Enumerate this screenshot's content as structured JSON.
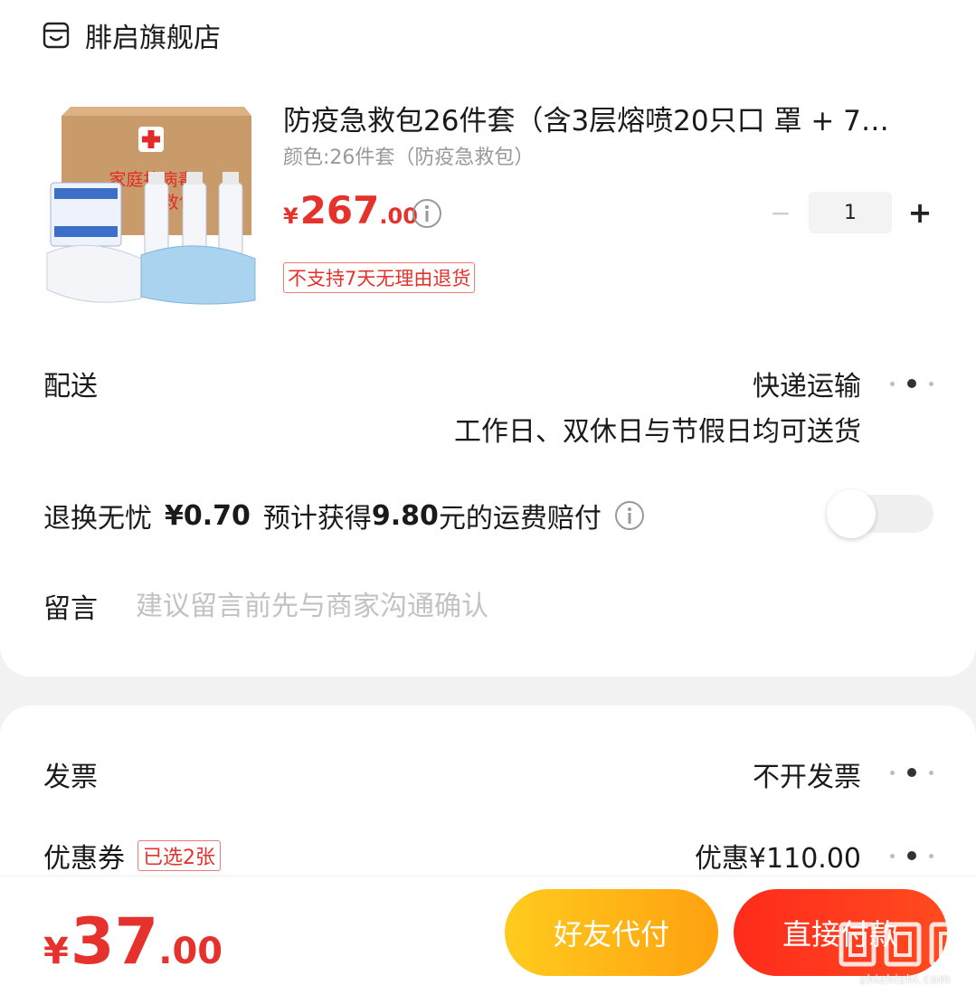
{
  "shop": {
    "name": "腓启旗舰店",
    "icon": "shop-icon"
  },
  "product": {
    "title": "防疫急救包26件套（含3层熔喷20只口 罩 + 7…",
    "variant": "颜色:26件套（防疫急救包）",
    "price_currency": "¥",
    "price_int": "267",
    "price_dec": ".00",
    "quantity": "1",
    "qty_minus": "−",
    "qty_plus": "+",
    "return_tag": "不支持7天无理由退货",
    "image_text_line1": "家庭抗病毒",
    "image_text_line2": "急救包"
  },
  "delivery": {
    "label": "配送",
    "method": "快递运输",
    "note": "工作日、双休日与节假日均可送货"
  },
  "return_worry": {
    "label": "退换无忧",
    "price": "¥0.70",
    "desc_prefix": "预计获得",
    "amount": "9.80",
    "desc_suffix": "元的运费赔付",
    "enabled": false
  },
  "message": {
    "label": "留言",
    "placeholder": "建议留言前先与商家沟通确认",
    "value": ""
  },
  "invoice": {
    "label": "发票",
    "value": "不开发票"
  },
  "coupon": {
    "label": "优惠券",
    "tag": "已选2张",
    "value": "优惠¥110.00"
  },
  "footer": {
    "total_currency": "¥",
    "total_int": "37",
    "total_dec": ".00",
    "friend_pay_label": "好友代付",
    "pay_label": "直接付款"
  },
  "watermark": {
    "text": "zhizhizhi.com"
  },
  "colors": {
    "accent_red": "#e5322d",
    "friend_btn": "#ffb414",
    "pay_btn": "#ff3320"
  }
}
